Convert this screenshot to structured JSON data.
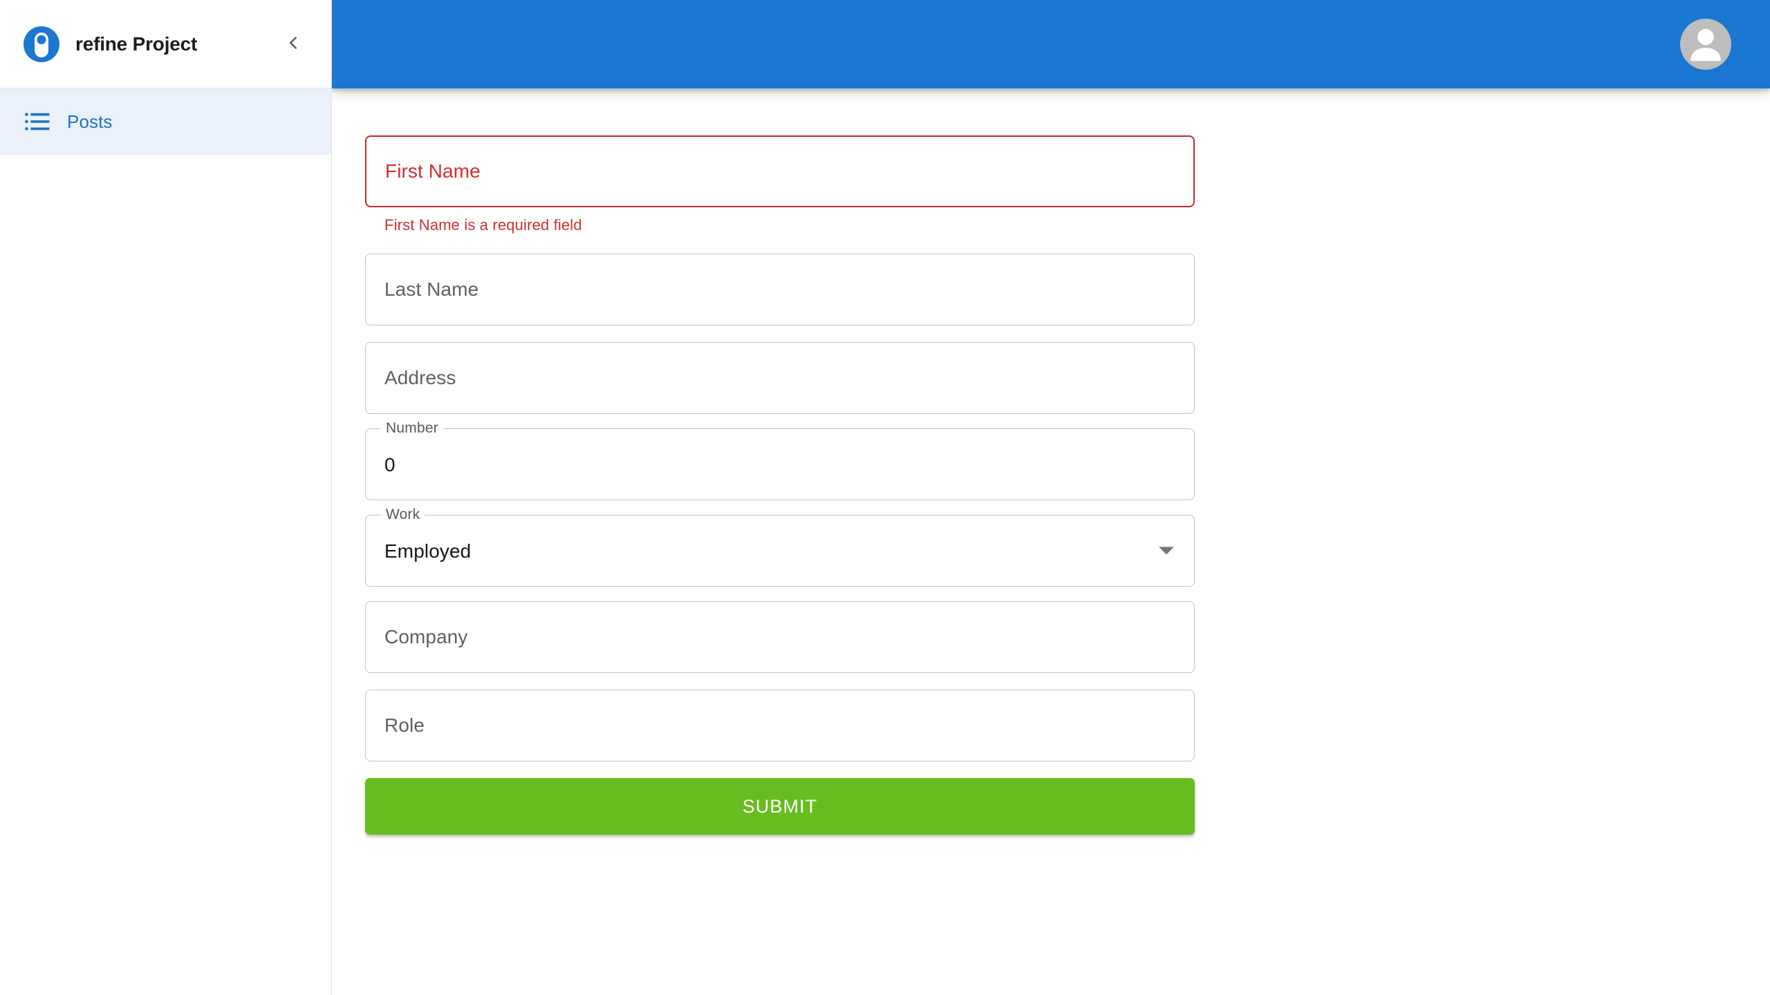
{
  "colors": {
    "appbar_blue": "#1a77d2",
    "nav_active_bg": "#eaf1fa",
    "nav_active_text": "#1c72c4",
    "error_red": "#cf3030",
    "submit_green": "#67bd1f",
    "placeholder_gray": "#5f5f5f"
  },
  "sidebar": {
    "brand": {
      "title": "refine Project",
      "logo_icon": "refine-logo-icon"
    },
    "collapse_icon": "chevron-left-icon",
    "items": [
      {
        "label": "Posts",
        "icon": "list-icon",
        "active": true
      }
    ]
  },
  "appbar": {
    "avatar_icon": "person-avatar-icon"
  },
  "form": {
    "fields": [
      {
        "id": "first-name",
        "kind": "text",
        "placeholder": "First Name",
        "value": "",
        "error": true,
        "helper_text": "First Name is a required field"
      },
      {
        "id": "last-name",
        "kind": "text",
        "placeholder": "Last Name",
        "value": "",
        "error": false
      },
      {
        "id": "address",
        "kind": "text",
        "placeholder": "Address",
        "value": "",
        "error": false
      },
      {
        "id": "number",
        "kind": "number",
        "label": "Number",
        "value": "0",
        "error": false
      },
      {
        "id": "work",
        "kind": "select",
        "label": "Work",
        "value": "Employed",
        "arrow_icon": "chevron-down-icon",
        "error": false
      },
      {
        "id": "company",
        "kind": "text",
        "placeholder": "Company",
        "value": "",
        "error": false
      },
      {
        "id": "role",
        "kind": "text",
        "placeholder": "Role",
        "value": "",
        "error": false
      }
    ],
    "submit_label": "SUBMIT"
  }
}
